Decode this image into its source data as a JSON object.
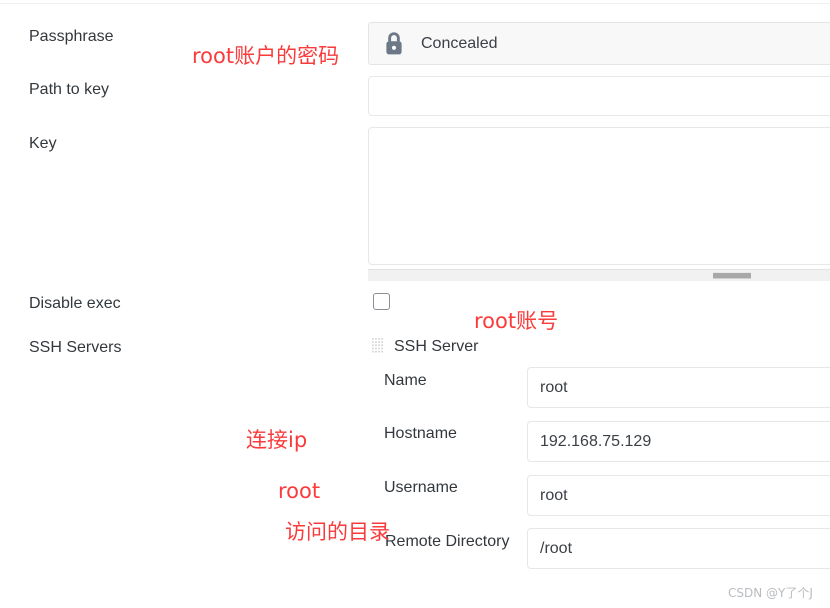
{
  "form": {
    "labels": {
      "passphrase": "Passphrase",
      "path_to_key": "Path to key",
      "key": "Key",
      "disable_exec": "Disable exec",
      "ssh_servers": "SSH Servers"
    },
    "passphrase": {
      "value": "Concealed",
      "icon": "lock-icon"
    },
    "path_to_key": {
      "value": "",
      "placeholder": ""
    },
    "key": {
      "value": "",
      "placeholder": ""
    },
    "disable_exec": {
      "checked": false
    }
  },
  "ssh_server": {
    "group_title": "SSH Server",
    "drag_handle_icon": "drag-handle-icon",
    "fields": [
      {
        "label": "Name",
        "value": "root"
      },
      {
        "label": "Hostname",
        "value": "192.168.75.129"
      },
      {
        "label": "Username",
        "value": "root"
      },
      {
        "label": "Remote Directory",
        "value": "/root"
      }
    ]
  },
  "annotations": {
    "color": "#fa3b3b",
    "passphrase_note": "root账户的密码",
    "account_note": "root账号",
    "ip_note": "连接ip",
    "user_note": "root",
    "directory_note": "访问的目录"
  },
  "watermark": {
    "text": "CSDN @Y了个J"
  }
}
